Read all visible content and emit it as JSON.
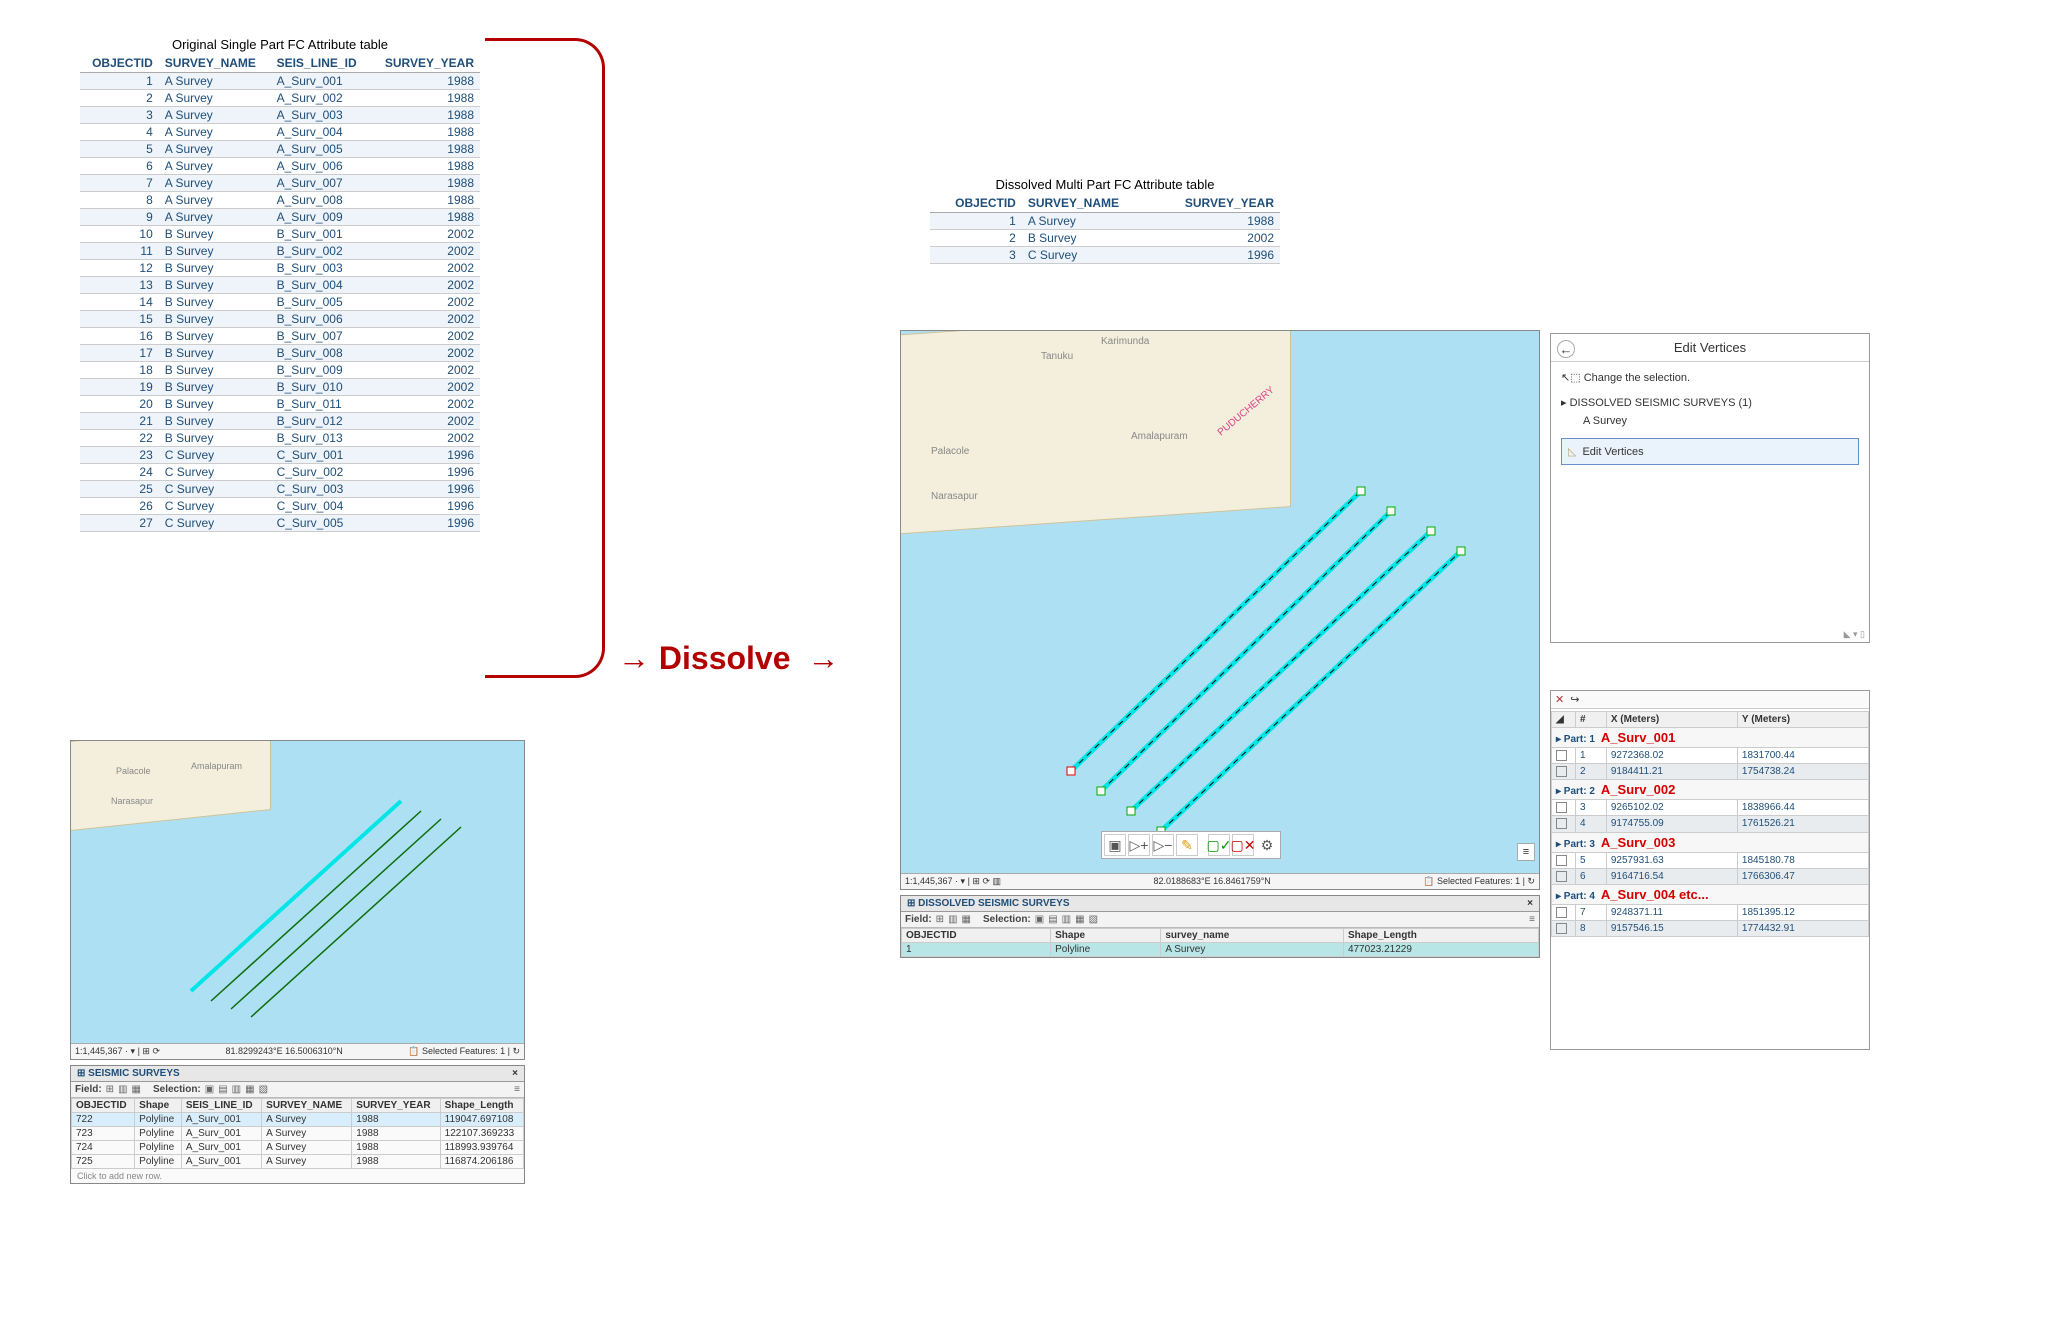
{
  "left_table": {
    "title": "Original Single Part FC Attribute table",
    "columns": [
      "OBJECTID",
      "SURVEY_NAME",
      "SEIS_LINE_ID",
      "SURVEY_YEAR"
    ],
    "rows": [
      {
        "id": 1,
        "name": "A Survey",
        "line": "A_Surv_001",
        "year": 1988
      },
      {
        "id": 2,
        "name": "A Survey",
        "line": "A_Surv_002",
        "year": 1988
      },
      {
        "id": 3,
        "name": "A Survey",
        "line": "A_Surv_003",
        "year": 1988
      },
      {
        "id": 4,
        "name": "A Survey",
        "line": "A_Surv_004",
        "year": 1988
      },
      {
        "id": 5,
        "name": "A Survey",
        "line": "A_Surv_005",
        "year": 1988
      },
      {
        "id": 6,
        "name": "A Survey",
        "line": "A_Surv_006",
        "year": 1988
      },
      {
        "id": 7,
        "name": "A Survey",
        "line": "A_Surv_007",
        "year": 1988
      },
      {
        "id": 8,
        "name": "A Survey",
        "line": "A_Surv_008",
        "year": 1988
      },
      {
        "id": 9,
        "name": "A Survey",
        "line": "A_Surv_009",
        "year": 1988
      },
      {
        "id": 10,
        "name": "B Survey",
        "line": "B_Surv_001",
        "year": 2002
      },
      {
        "id": 11,
        "name": "B Survey",
        "line": "B_Surv_002",
        "year": 2002
      },
      {
        "id": 12,
        "name": "B Survey",
        "line": "B_Surv_003",
        "year": 2002
      },
      {
        "id": 13,
        "name": "B Survey",
        "line": "B_Surv_004",
        "year": 2002
      },
      {
        "id": 14,
        "name": "B Survey",
        "line": "B_Surv_005",
        "year": 2002
      },
      {
        "id": 15,
        "name": "B Survey",
        "line": "B_Surv_006",
        "year": 2002
      },
      {
        "id": 16,
        "name": "B Survey",
        "line": "B_Surv_007",
        "year": 2002
      },
      {
        "id": 17,
        "name": "B Survey",
        "line": "B_Surv_008",
        "year": 2002
      },
      {
        "id": 18,
        "name": "B Survey",
        "line": "B_Surv_009",
        "year": 2002
      },
      {
        "id": 19,
        "name": "B Survey",
        "line": "B_Surv_010",
        "year": 2002
      },
      {
        "id": 20,
        "name": "B Survey",
        "line": "B_Surv_011",
        "year": 2002
      },
      {
        "id": 21,
        "name": "B Survey",
        "line": "B_Surv_012",
        "year": 2002
      },
      {
        "id": 22,
        "name": "B Survey",
        "line": "B_Surv_013",
        "year": 2002
      },
      {
        "id": 23,
        "name": "C Survey",
        "line": "C_Surv_001",
        "year": 1996
      },
      {
        "id": 24,
        "name": "C Survey",
        "line": "C_Surv_002",
        "year": 1996
      },
      {
        "id": 25,
        "name": "C Survey",
        "line": "C_Surv_003",
        "year": 1996
      },
      {
        "id": 26,
        "name": "C Survey",
        "line": "C_Surv_004",
        "year": 1996
      },
      {
        "id": 27,
        "name": "C Survey",
        "line": "C_Surv_005",
        "year": 1996
      }
    ]
  },
  "bottom_left_map": {
    "scale": "1:1,445,367",
    "coords": "81.8299243°E 16.5006310°N",
    "selected": "Selected Features: 1",
    "places": [
      "Palacole",
      "Amalapuram",
      "Narasapur"
    ],
    "attr_tab": {
      "title": "SEISMIC SURVEYS",
      "toolbar": {
        "field": "Field:",
        "selection": "Selection:"
      },
      "columns": [
        "OBJECTID",
        "Shape",
        "SEIS_LINE_ID",
        "SURVEY_NAME",
        "SURVEY_YEAR",
        "Shape_Length"
      ],
      "rows": [
        {
          "id": 722,
          "shape": "Polyline",
          "line": "A_Surv_001",
          "name": "A Survey",
          "year": 1988,
          "len": "119047.697108"
        },
        {
          "id": 723,
          "shape": "Polyline",
          "line": "A_Surv_001",
          "name": "A Survey",
          "year": 1988,
          "len": "122107.369233"
        },
        {
          "id": 724,
          "shape": "Polyline",
          "line": "A_Surv_001",
          "name": "A Survey",
          "year": 1988,
          "len": "118993.939764"
        },
        {
          "id": 725,
          "shape": "Polyline",
          "line": "A_Surv_001",
          "name": "A Survey",
          "year": 1988,
          "len": "116874.206186"
        }
      ],
      "footer": "Click to add new row."
    }
  },
  "dissolve": {
    "label": "Dissolve",
    "arrow": "→"
  },
  "right_table": {
    "title": "Dissolved Multi Part FC Attribute table",
    "columns": [
      "OBJECTID",
      "SURVEY_NAME",
      "SURVEY_YEAR"
    ],
    "rows": [
      {
        "id": 1,
        "name": "A Survey",
        "year": 1988
      },
      {
        "id": 2,
        "name": "B Survey",
        "year": 2002
      },
      {
        "id": 3,
        "name": "C Survey",
        "year": 1996
      }
    ]
  },
  "right_map": {
    "scale": "1:1,445,367",
    "coords": "82.0188683°E 16.8461759°N",
    "selected": "Selected Features: 1",
    "places": [
      "Tanuku",
      "Palacole",
      "Amalapuram",
      "Narasapur",
      "PUDUCHERRY",
      "Karimunda"
    ],
    "attr_tab": {
      "title": "DISSOLVED SEISMIC SURVEYS",
      "toolbar": {
        "field": "Field:",
        "selection": "Selection:"
      },
      "columns": [
        "OBJECTID",
        "Shape",
        "survey_name",
        "Shape_Length"
      ],
      "rows": [
        {
          "id": 1,
          "shape": "Polyline",
          "name": "A Survey",
          "len": "477023.21229"
        }
      ]
    }
  },
  "edit_panel": {
    "title": "Edit Vertices",
    "change_sel": "Change the selection.",
    "layer": "DISSOLVED SEISMIC SURVEYS (1)",
    "feature": "A Survey",
    "op_label": "Edit Vertices"
  },
  "vertex_grid": {
    "columns": [
      "#",
      "X (Meters)",
      "Y (Meters)"
    ],
    "parts": [
      {
        "label": "Part: 1",
        "anno": "A_Surv_001",
        "rows": [
          {
            "n": 1,
            "x": "9272368.02",
            "y": "1831700.44"
          },
          {
            "n": 2,
            "x": "9184411.21",
            "y": "1754738.24"
          }
        ]
      },
      {
        "label": "Part: 2",
        "anno": "A_Surv_002",
        "rows": [
          {
            "n": 3,
            "x": "9265102.02",
            "y": "1838966.44"
          },
          {
            "n": 4,
            "x": "9174755.09",
            "y": "1761526.21"
          }
        ]
      },
      {
        "label": "Part: 3",
        "anno": "A_Surv_003",
        "rows": [
          {
            "n": 5,
            "x": "9257931.63",
            "y": "1845180.78"
          },
          {
            "n": 6,
            "x": "9164716.54",
            "y": "1766306.47"
          }
        ]
      },
      {
        "label": "Part: 4",
        "anno": "A_Surv_004  etc...",
        "rows": [
          {
            "n": 7,
            "x": "9248371.11",
            "y": "1851395.12"
          },
          {
            "n": 8,
            "x": "9157546.15",
            "y": "1774432.91"
          }
        ]
      }
    ]
  }
}
